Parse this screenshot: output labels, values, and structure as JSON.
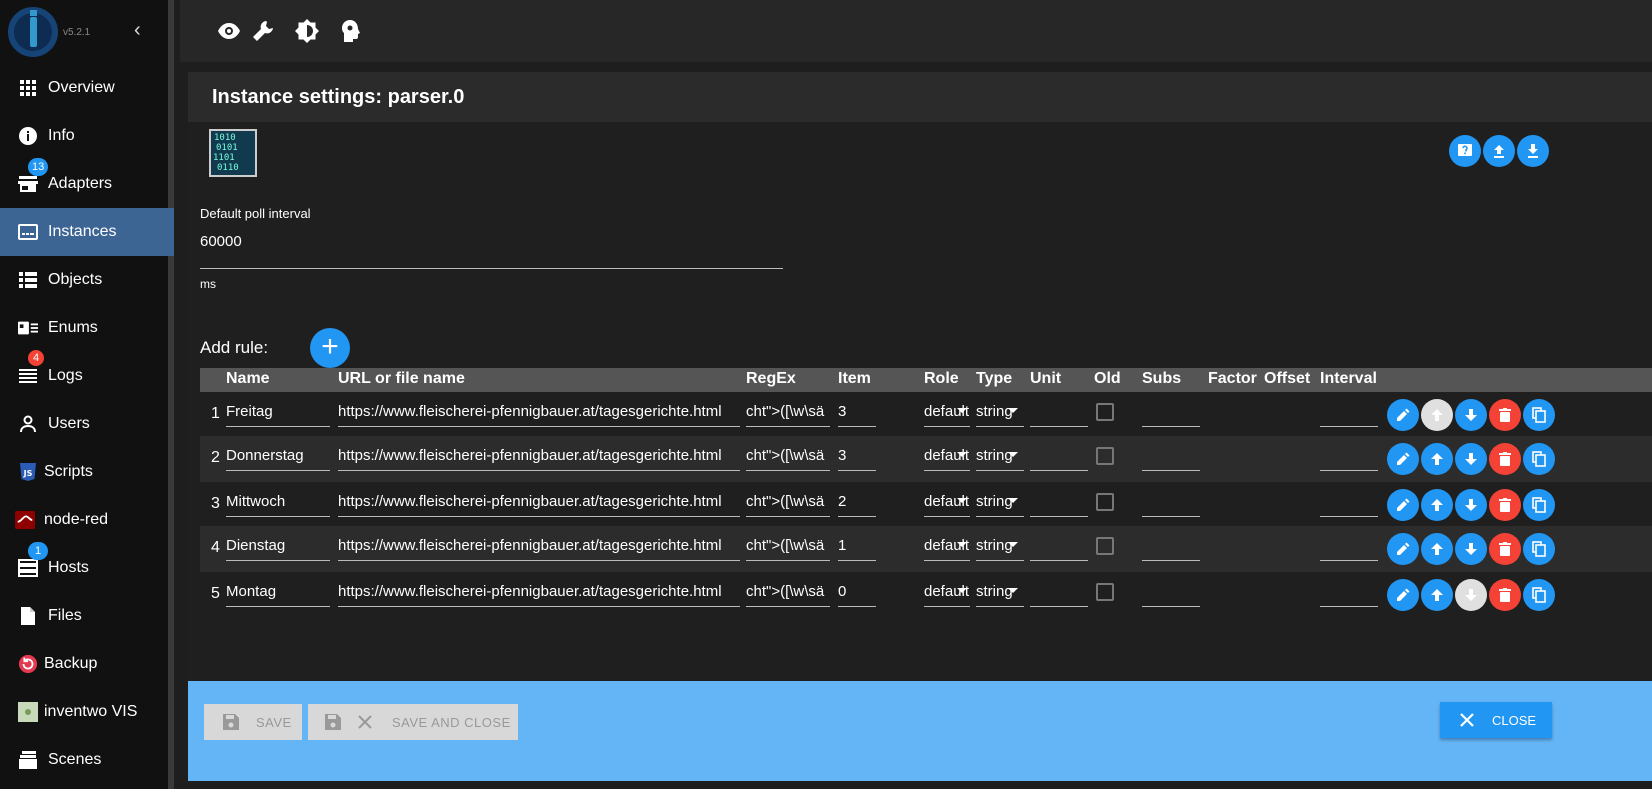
{
  "app": {
    "version": "v5.2.1"
  },
  "sidebar": {
    "items": [
      {
        "label": "Overview",
        "icon": "grid-icon"
      },
      {
        "label": "Info",
        "icon": "info-icon"
      },
      {
        "label": "Adapters",
        "icon": "store-icon",
        "badge": "13"
      },
      {
        "label": "Instances",
        "icon": "instances-icon",
        "active": true
      },
      {
        "label": "Objects",
        "icon": "list-icon"
      },
      {
        "label": "Enums",
        "icon": "enums-icon"
      },
      {
        "label": "Logs",
        "icon": "logs-icon",
        "badge": "4"
      },
      {
        "label": "Users",
        "icon": "user-icon"
      },
      {
        "label": "Scripts",
        "icon": "js-icon"
      },
      {
        "label": "node-red",
        "icon": "node-red-icon"
      },
      {
        "label": "Hosts",
        "icon": "hosts-icon",
        "badge": "1"
      },
      {
        "label": "Files",
        "icon": "file-icon"
      },
      {
        "label": "Backup",
        "icon": "backup-icon"
      },
      {
        "label": "inventwo VIS",
        "icon": "inventwo-icon"
      },
      {
        "label": "Scenes",
        "icon": "scenes-icon"
      }
    ]
  },
  "topbar": {
    "icons": [
      "eye-icon",
      "wrench-icon",
      "brightness-icon",
      "expert-mode-icon"
    ]
  },
  "panel": {
    "title": "Instance settings: parser.0",
    "poll_label": "Default poll interval",
    "poll_value": "60000",
    "poll_help": "ms",
    "add_rule_label": "Add rule:"
  },
  "table": {
    "headers": [
      "Name",
      "URL or file name",
      "RegEx",
      "Item",
      "Role",
      "Type",
      "Unit",
      "Old",
      "Subs",
      "Factor",
      "Offset",
      "Interval"
    ],
    "rows": [
      {
        "num": "1",
        "name": "Freitag",
        "url": "https://www.fleischerei-pfennigbauer.at/tagesgerichte.html",
        "regex": "cht\">([\\w\\sä",
        "item": "3",
        "role": "default",
        "type": "string"
      },
      {
        "num": "2",
        "name": "Donnerstag",
        "url": "https://www.fleischerei-pfennigbauer.at/tagesgerichte.html",
        "regex": "cht\">([\\w\\sä",
        "item": "3",
        "role": "default",
        "type": "string"
      },
      {
        "num": "3",
        "name": "Mittwoch",
        "url": "https://www.fleischerei-pfennigbauer.at/tagesgerichte.html",
        "regex": "cht\">([\\w\\sä",
        "item": "2",
        "role": "default",
        "type": "string"
      },
      {
        "num": "4",
        "name": "Dienstag",
        "url": "https://www.fleischerei-pfennigbauer.at/tagesgerichte.html",
        "regex": "cht\">([\\w\\sä",
        "item": "1",
        "role": "default",
        "type": "string"
      },
      {
        "num": "5",
        "name": "Montag",
        "url": "https://www.fleischerei-pfennigbauer.at/tagesgerichte.html",
        "regex": "cht\">([\\w\\sä",
        "item": "0",
        "role": "default",
        "type": "string"
      }
    ]
  },
  "footer": {
    "save_label": "SAVE",
    "save_close_label": "SAVE AND CLOSE",
    "close_label": "CLOSE"
  },
  "colors": {
    "accent": "#2196f3",
    "danger": "#f44336",
    "active_nav": "#3c6594",
    "footer_bg": "#64b5f6"
  }
}
